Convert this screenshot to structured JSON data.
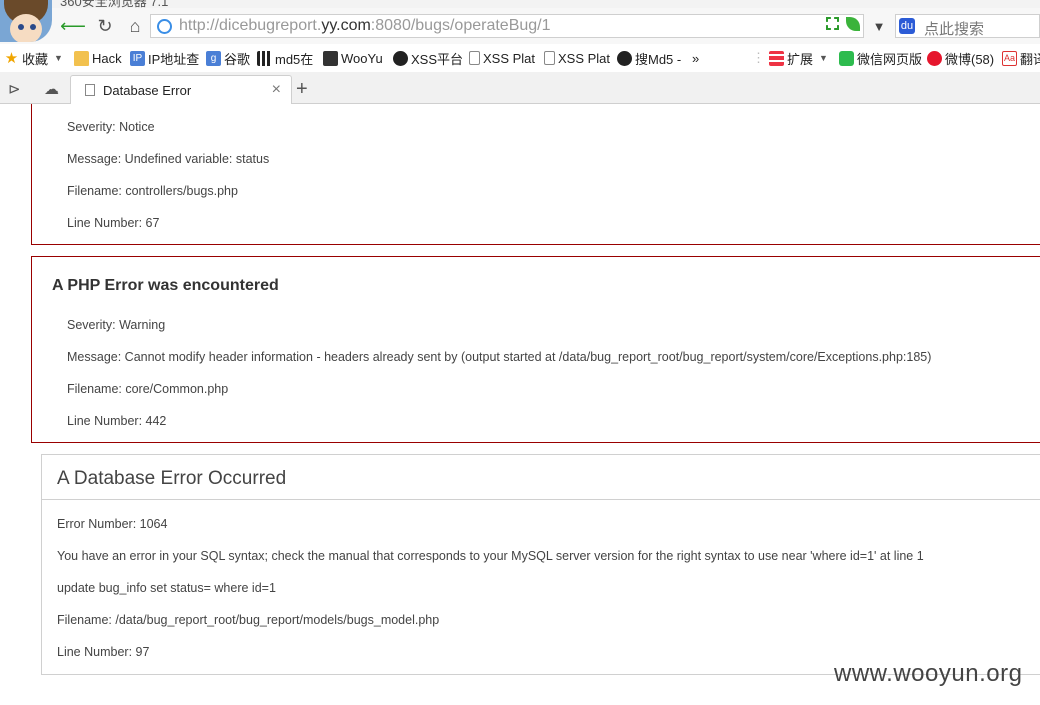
{
  "browser": {
    "window_title": "360安全浏览器 7.1",
    "url_gray_prefix": "http://dicebugreport.",
    "url_domain": "yy.com",
    "url_suffix": ":8080/bugs/operateBug/1",
    "search_placeholder": "点此搜索",
    "bookmarks": [
      {
        "label": "收藏",
        "icon": "star-icon"
      },
      {
        "label": "Hack",
        "icon": "folder-icon"
      },
      {
        "label": "IP地址查",
        "icon": "ip-icon"
      },
      {
        "label": "谷歌",
        "icon": "google-icon"
      },
      {
        "label": "md5在",
        "icon": "md5-icon"
      },
      {
        "label": "WooYu",
        "icon": "wooyun-icon"
      },
      {
        "label": "XSS平台",
        "icon": "skull-icon"
      },
      {
        "label": "XSS Plat",
        "icon": "page-icon"
      },
      {
        "label": "XSS Plat",
        "icon": "page-icon"
      },
      {
        "label": "搜Md5 -",
        "icon": "md5-search-icon"
      },
      {
        "label": "»",
        "icon": "overflow-icon"
      },
      {
        "label": "扩展",
        "icon": "apps-icon"
      },
      {
        "label": "微信网页版",
        "icon": "wechat-icon"
      },
      {
        "label": "微博(58)",
        "icon": "weibo-icon"
      },
      {
        "label": "翻译",
        "icon": "translate-icon"
      }
    ],
    "tab_title": "Database Error"
  },
  "errors": [
    {
      "heading": "",
      "severity": "Severity: Notice",
      "message": "Message: Undefined variable: status",
      "filename": "Filename: controllers/bugs.php",
      "line": "Line Number: 67"
    },
    {
      "heading": "A PHP Error was encountered",
      "severity": "Severity: Warning",
      "message": "Message: Cannot modify header information - headers already sent by (output started at /data/bug_report_root/bug_report/system/core/Exceptions.php:185)",
      "filename": "Filename: core/Common.php",
      "line": "Line Number: 442"
    }
  ],
  "database_error": {
    "heading": "A Database Error Occurred",
    "error_number": "Error Number: 1064",
    "message": "You have an error in your SQL syntax; check the manual that corresponds to your MySQL server version for the right syntax to use near 'where id=1' at line 1",
    "query": "update bug_info set status= where id=1",
    "filename": "Filename: /data/bug_report_root/bug_report/models/bugs_model.php",
    "line": "Line Number: 97"
  },
  "watermark": "www.wooyun.org",
  "colors": {
    "php_border": "#990000",
    "db_border": "#d0d0d0",
    "url_gray": "#999999"
  }
}
